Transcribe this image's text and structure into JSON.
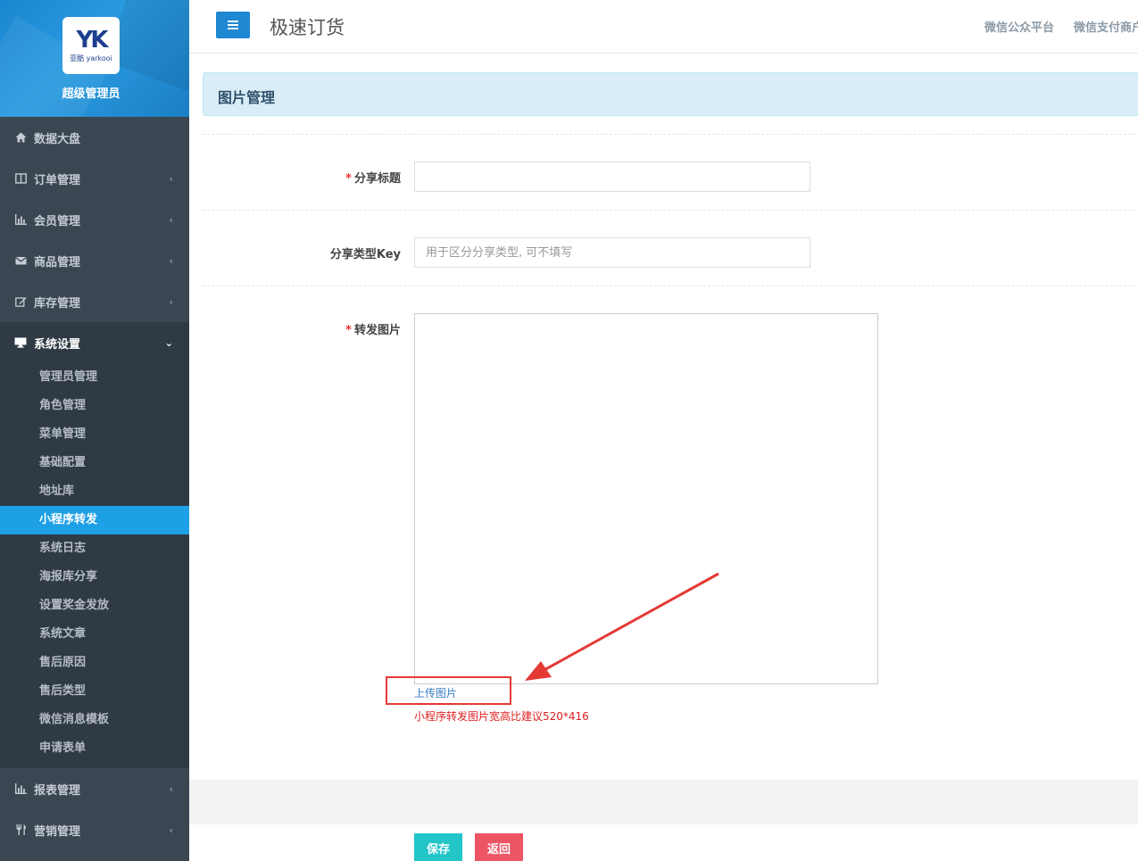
{
  "sidebar": {
    "logo": {
      "mark": "YK",
      "sub": "亚酷 yarkooi"
    },
    "admin_name": "超级管理员",
    "menu": [
      {
        "label": "数据大盘",
        "icon": "home-icon",
        "has_children": false
      },
      {
        "label": "订单管理",
        "icon": "columns-icon",
        "has_children": true
      },
      {
        "label": "会员管理",
        "icon": "bar-chart-icon",
        "has_children": true
      },
      {
        "label": "商品管理",
        "icon": "envelope-icon",
        "has_children": true
      },
      {
        "label": "库存管理",
        "icon": "edit-icon",
        "has_children": true
      }
    ],
    "open_menu": {
      "label": "系统设置",
      "icon": "desktop-icon",
      "items": [
        "管理员管理",
        "角色管理",
        "菜单管理",
        "基础配置",
        "地址库",
        "小程序转发",
        "系统日志",
        "海报库分享",
        "设置奖金发放",
        "系统文章",
        "售后原因",
        "售后类型",
        "微信消息模板",
        "申请表单"
      ],
      "active_index": 5
    },
    "bottom_menu": [
      {
        "label": "报表管理",
        "icon": "bar-chart-icon"
      },
      {
        "label": "营销管理",
        "icon": "cutlery-icon"
      }
    ]
  },
  "topbar": {
    "title": "极速订货",
    "links": [
      "微信公众平台",
      "微信支付商户"
    ]
  },
  "panel": {
    "title": "图片管理"
  },
  "form": {
    "share_title": {
      "label": "分享标题",
      "required": true,
      "value": "",
      "placeholder": ""
    },
    "share_key": {
      "label": "分享类型Key",
      "required": false,
      "value": "",
      "placeholder": "用于区分分享类型, 可不填写"
    },
    "forward_image": {
      "label": "转发图片",
      "required": true,
      "upload_label": "上传图片",
      "hint": "小程序转发图片宽高比建议520*416"
    }
  },
  "actions": {
    "save": "保存",
    "back": "返回"
  },
  "colors": {
    "accent": "#1ea0e6",
    "sidebar": "#3a4652",
    "save": "#23c6c8",
    "back": "#ed5565",
    "highlight": "#e53935"
  }
}
